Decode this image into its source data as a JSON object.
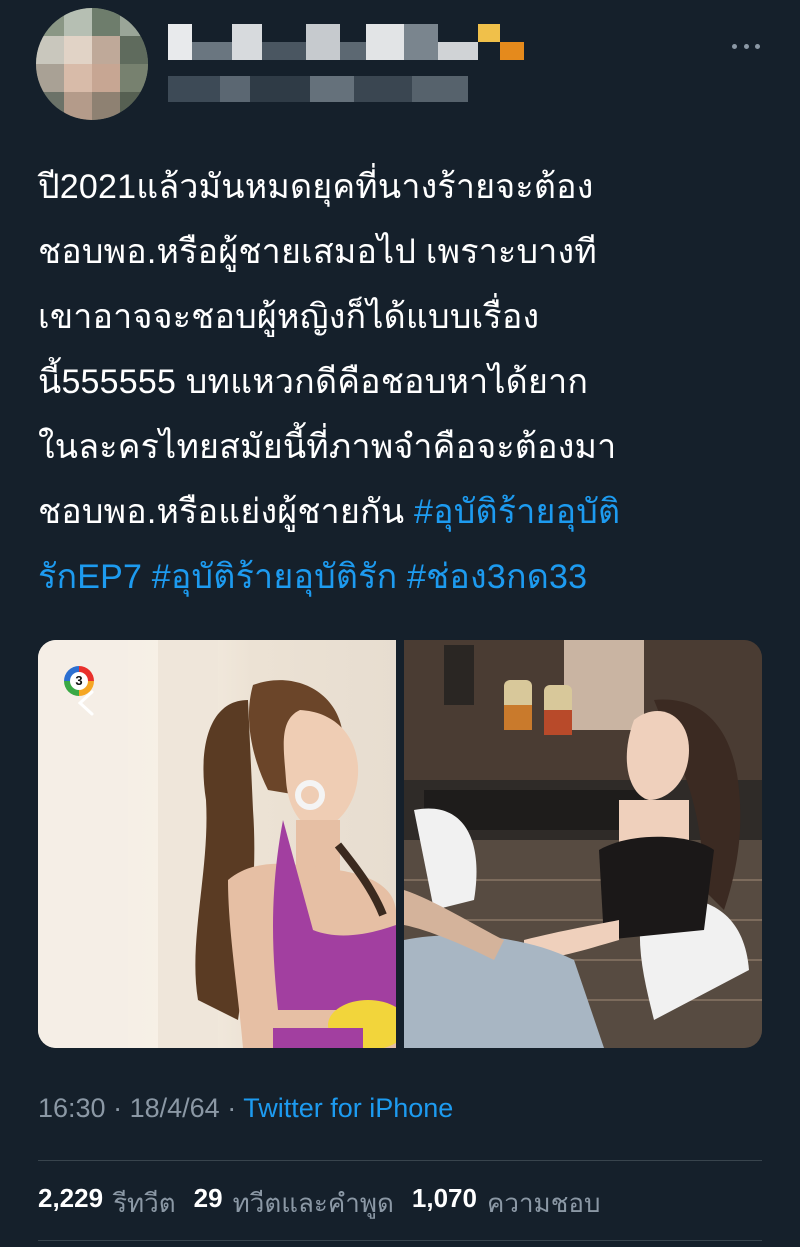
{
  "tweet": {
    "text_lines": [
      "ปี2021แล้วมันหมดยุคที่นางร้ายจะต้อง",
      "ชอบพอ.หรือผู้ชายเสมอไป เพราะบางที",
      "เขาอาจจะชอบผู้หญิงก็ได้แบบเรื่อง",
      "นี้555555 บทแหวกดีคือชอบหาได้ยาก",
      " ในละครไทยสมัยนี้ที่ภาพจำคือจะต้องมา",
      "ชอบพอ.หรือแย่งผู้ชายกัน "
    ],
    "hashtags": {
      "tag1_part1": "#อุบัติร้ายอุบัติ",
      "tag1_part2": "รักEP7",
      "tag2": "#อุบัติร้ายอุบัติรัก",
      "tag3": "#ช่อง3กด33"
    },
    "media": {
      "channel_logo_text": "3"
    },
    "meta": {
      "time": "16:30",
      "date": "18/4/64",
      "separator": "·",
      "source": "Twitter for iPhone"
    },
    "stats": {
      "retweets_count": "2,229",
      "retweets_label": "รีทวีต",
      "quotes_count": "29",
      "quotes_label": "ทวีตและคำพูด",
      "likes_count": "1,070",
      "likes_label": "ความชอบ"
    }
  },
  "icons": {
    "more": "more-horizontal-icon",
    "channel": "channel-3-logo"
  },
  "colors": {
    "background": "#15202b",
    "text": "#ffffff",
    "secondary": "#8b98a5",
    "link": "#1d9bf0",
    "divider": "#38444d"
  }
}
